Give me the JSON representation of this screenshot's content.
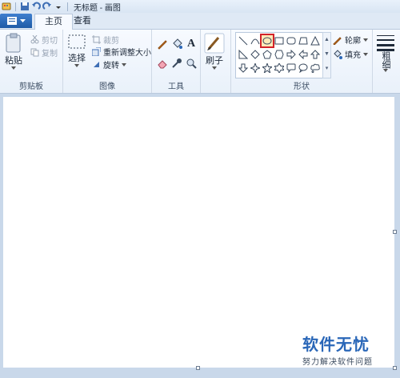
{
  "window": {
    "title": "无标题 - 画图"
  },
  "tabs": {
    "file_label": "",
    "home": "主页",
    "view": "查看"
  },
  "clipboard": {
    "paste": "粘贴",
    "cut": "剪切",
    "copy": "复制",
    "group": "剪贴板"
  },
  "image": {
    "select": "选择",
    "crop": "裁剪",
    "resize": "重新调整大小",
    "rotate": "旋转",
    "group": "图像"
  },
  "tools": {
    "group": "工具",
    "text_glyph": "A"
  },
  "brushes": {
    "label": "刷子"
  },
  "shapes": {
    "group": "形状",
    "outline": "轮廓",
    "fill": "填充",
    "selected": "oval"
  },
  "size": {
    "label": "粗细"
  },
  "colors": {
    "accent": "#2a67b8",
    "selected_outline": "#d2232a"
  },
  "watermark": {
    "title": "软件无忧",
    "subtitle": "努力解决软件问题"
  }
}
